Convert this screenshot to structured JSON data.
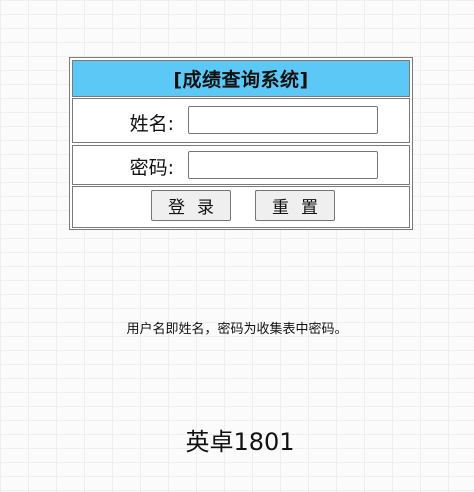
{
  "form": {
    "title": "[成绩查询系统]",
    "name_label": "姓名:",
    "name_value": "",
    "password_label": "密码:",
    "password_value": "",
    "login_button": "登录",
    "reset_button": "重置"
  },
  "hint": "用户名即姓名，密码为收集表中密码。",
  "footer": "英卓1801",
  "colors": {
    "title_bg": "#5cc8f5",
    "border": "#7a7a7a",
    "page_bg": "#fbfbfb"
  }
}
